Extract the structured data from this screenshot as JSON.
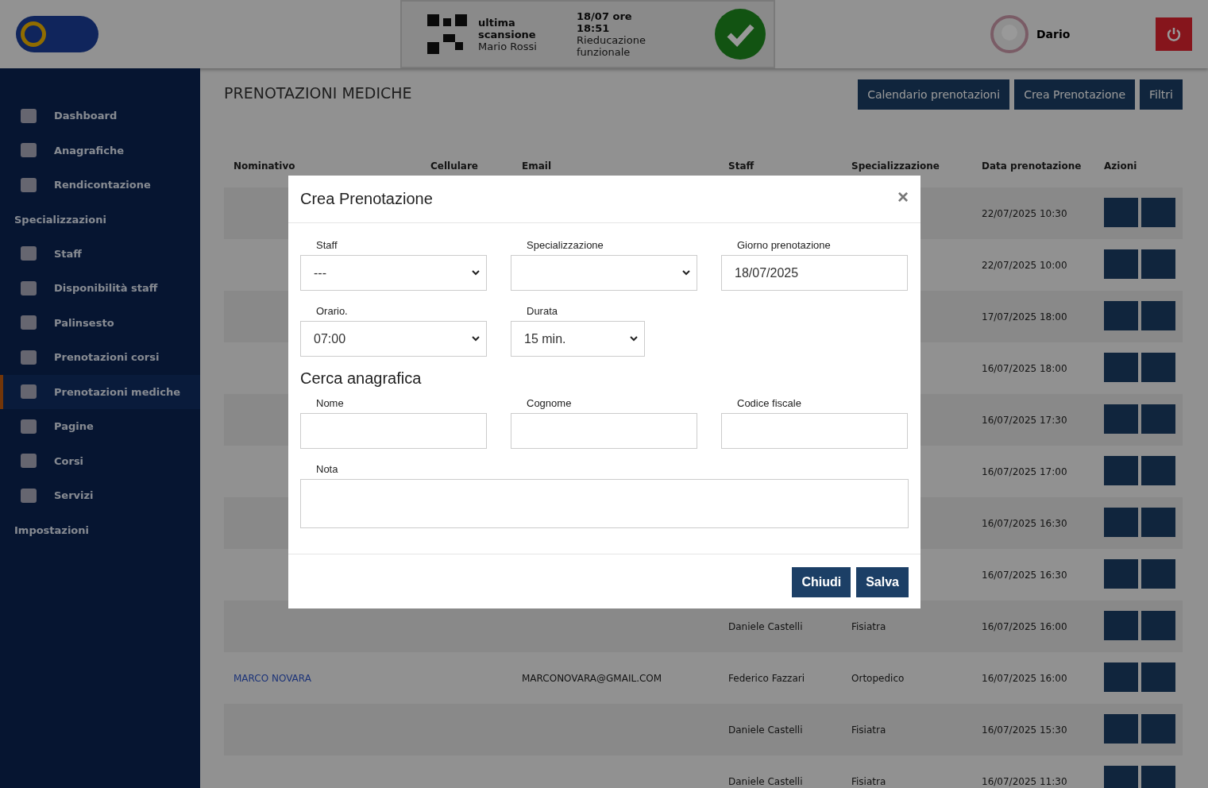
{
  "header": {
    "scan": {
      "label": "ultima scansione",
      "person": "Mario Rossi",
      "time": "18/07 ore 18:51",
      "activity": "Rieducazione funzionale"
    },
    "user": {
      "name": "Dario"
    }
  },
  "sidebar": {
    "items": [
      {
        "kind": "link",
        "label": "Dashboard",
        "selected": false
      },
      {
        "kind": "link",
        "label": "Anagrafiche",
        "selected": false
      },
      {
        "kind": "link",
        "label": "Rendicontazione",
        "selected": false
      },
      {
        "kind": "section",
        "label": "Specializzazioni"
      },
      {
        "kind": "link",
        "label": "Staff",
        "selected": false
      },
      {
        "kind": "link",
        "label": "Disponibilità staff",
        "selected": false
      },
      {
        "kind": "link",
        "label": "Palinsesto",
        "selected": false
      },
      {
        "kind": "link",
        "label": "Prenotazioni corsi",
        "selected": false
      },
      {
        "kind": "link",
        "label": "Prenotazioni mediche",
        "selected": true
      },
      {
        "kind": "link",
        "label": "Pagine",
        "selected": false
      },
      {
        "kind": "link",
        "label": "Corsi",
        "selected": false
      },
      {
        "kind": "link",
        "label": "Servizi",
        "selected": false
      },
      {
        "kind": "section",
        "label": "Impostazioni"
      }
    ]
  },
  "page": {
    "title": "PRENOTAZIONI MEDICHE",
    "buttons": [
      "Calendario prenotazioni",
      "Crea Prenotazione",
      "Filtri"
    ]
  },
  "table": {
    "columns": [
      "Nominativo",
      "Cellulare",
      "Email",
      "Staff",
      "Specializzazione",
      "Data prenotazione",
      "Azioni"
    ],
    "rows": [
      {
        "date": "22/07/2025 10:30"
      },
      {
        "date": "22/07/2025 10:00"
      },
      {
        "date": "17/07/2025 18:00"
      },
      {
        "date": "16/07/2025 18:00"
      },
      {
        "date": "16/07/2025 17:30"
      },
      {
        "date": "16/07/2025 17:00"
      },
      {
        "date": "16/07/2025 16:30"
      },
      {
        "date": "16/07/2025 16:30"
      },
      {
        "staff": "Daniele Castelli",
        "specialization": "Fisiatra",
        "date": "16/07/2025 16:00"
      },
      {
        "name": "MARCO NOVARA",
        "email": "MARCONOVARA@GMAIL.COM",
        "staff": "Federico Fazzari",
        "specialization": "Ortopedico",
        "date": "16/07/2025 16:00"
      },
      {
        "staff": "Daniele Castelli",
        "specialization": "Fisiatra",
        "date": "16/07/2025 15:30"
      },
      {
        "staff": "Daniele Castelli",
        "specialization": "Fisiatra",
        "date": "16/07/2025 11:30"
      }
    ]
  },
  "modal": {
    "title": "Crea Prenotazione",
    "close": "×",
    "fields": [
      {
        "kind": "select",
        "label": "Staff",
        "value": "---"
      },
      {
        "kind": "select",
        "label": "Specializzazione"
      },
      {
        "kind": "text",
        "label": "Giorno prenotazione",
        "value": "18/07/2025"
      },
      {
        "kind": "select",
        "label": "Orario.",
        "value": "07:00"
      },
      {
        "kind": "select",
        "label": "Durata",
        "value": "15 min.",
        "narrow": true
      }
    ],
    "section": "Cerca anagrafica",
    "search_fields": [
      {
        "label": "Nome"
      },
      {
        "label": "Cognome"
      },
      {
        "label": "Codice fiscale"
      }
    ],
    "note": {
      "label": "Nota"
    },
    "buttons": [
      "Chiudi",
      "Salva"
    ]
  }
}
